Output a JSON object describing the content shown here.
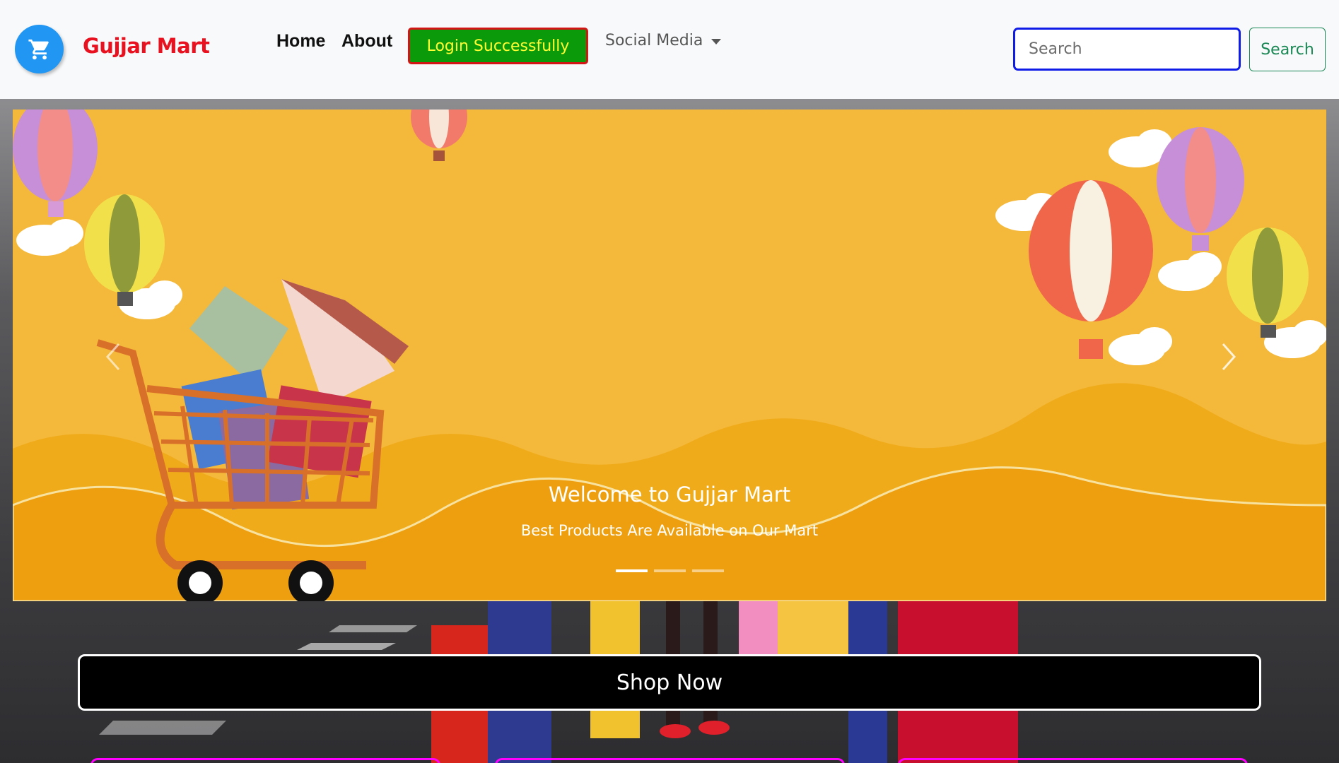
{
  "navbar": {
    "brand": "Gujjar Mart",
    "logo_icon": "cart-icon",
    "links": [
      {
        "label": "Home"
      },
      {
        "label": "About"
      }
    ],
    "login_button": "Login Successfully",
    "social_dropdown": "Social Media",
    "search": {
      "placeholder": "Search",
      "value": "",
      "button": "Search"
    }
  },
  "carousel": {
    "caption_title": "Welcome to Gujjar Mart",
    "caption_subtitle": "Best Products Are Available on Our Mart",
    "slide_count": 3,
    "active_slide": 1,
    "prev_icon": "chevron-left-icon",
    "next_icon": "chevron-right-icon"
  },
  "shop_now": "Shop Now",
  "colors": {
    "brand": "#e8111f",
    "login_bg": "#0a9a0a",
    "login_border": "#d41515",
    "login_text": "#ffff33",
    "search_border": "#0f1be6",
    "search_button": "#198754",
    "card_border": "#ff00ff",
    "banner": "#f4b535"
  }
}
